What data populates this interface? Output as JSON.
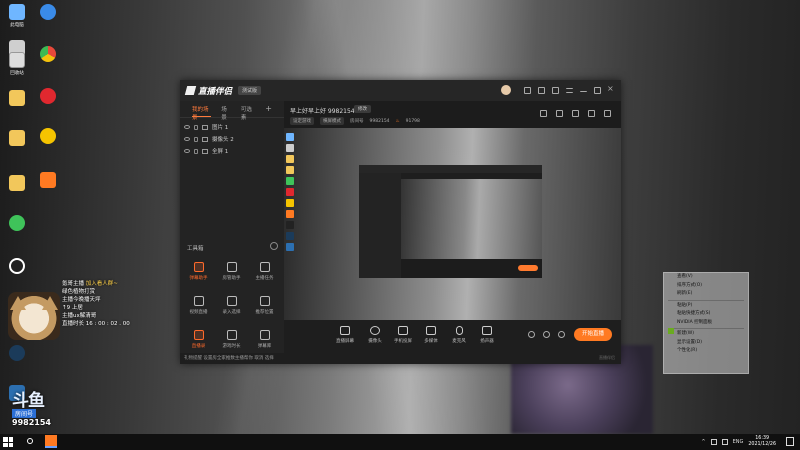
{
  "desktop": {
    "icons_col1": [
      "此电脑",
      "",
      "回收站",
      "",
      "",
      "",
      "",
      "",
      "",
      "",
      "",
      ""
    ],
    "icons_col2": [
      "",
      "",
      "",
      "",
      "",
      "",
      ""
    ]
  },
  "chat": {
    "lines": [
      {
        "text": "氪哥主播  ",
        "highlight": "加入看人群~"
      },
      {
        "text": "绿色植物打赏",
        "highlight": ""
      },
      {
        "text": "  主播今晚播天坪",
        "highlight": ""
      },
      {
        "text": "  ↑9 上居",
        "highlight": ""
      },
      {
        "text": "  主播ux解清哥",
        "highlight": ""
      },
      {
        "text": "  直播时长  16 : 00 : 02 . 00",
        "highlight": ""
      }
    ]
  },
  "logo": {
    "mark": "斗鱼",
    "sub": "房间号",
    "room": "9982154"
  },
  "app": {
    "brand": "直播伴侣",
    "version": "测试版",
    "tabs": [
      "我的场景",
      "场景",
      "可选素"
    ],
    "scenes": [
      "图片 1",
      "摄像头 2",
      "全屏 1"
    ],
    "toolbox_title": "工具箱",
    "tools": [
      {
        "label": "弹幕助手",
        "active": true
      },
      {
        "label": "房管助手",
        "active": false
      },
      {
        "label": "主播任务",
        "active": false
      },
      {
        "label": "视频直播",
        "active": false
      },
      {
        "label": "录入选择",
        "active": false
      },
      {
        "label": "推荐位置",
        "active": false
      },
      {
        "label": "直播录",
        "active": true
      },
      {
        "label": "游戏时长",
        "active": false
      },
      {
        "label": "弹幕库",
        "active": false
      }
    ],
    "notice": "礼物提醒  设置房全家推数主播帮你  取消 选择",
    "room_title": "早上好早上好 9982154",
    "edit_label": "修改",
    "meta": {
      "category": "设定游戏",
      "mode": "横屏模式",
      "room_label": "房间号",
      "room_id": "9982154",
      "heat": "91798"
    },
    "controls": [
      "直播屏幕",
      "摄像头",
      "手机投屏",
      "多媒体",
      "麦克风",
      "扬声器"
    ],
    "start_button": "开始直播",
    "watermark": "直播伴侣"
  },
  "context_menu": {
    "items": [
      "查看(V)",
      "排序方式(O)",
      "刷新(E)",
      "",
      "粘贴(P)",
      "粘贴快捷方式(S)",
      "NVIDIA 控制面板",
      "新建(W)",
      "显示设置(D)",
      "个性化(R)"
    ]
  },
  "taskbar": {
    "tray_lang": "ENG",
    "time": "16:39",
    "date": "2021/12/26"
  }
}
